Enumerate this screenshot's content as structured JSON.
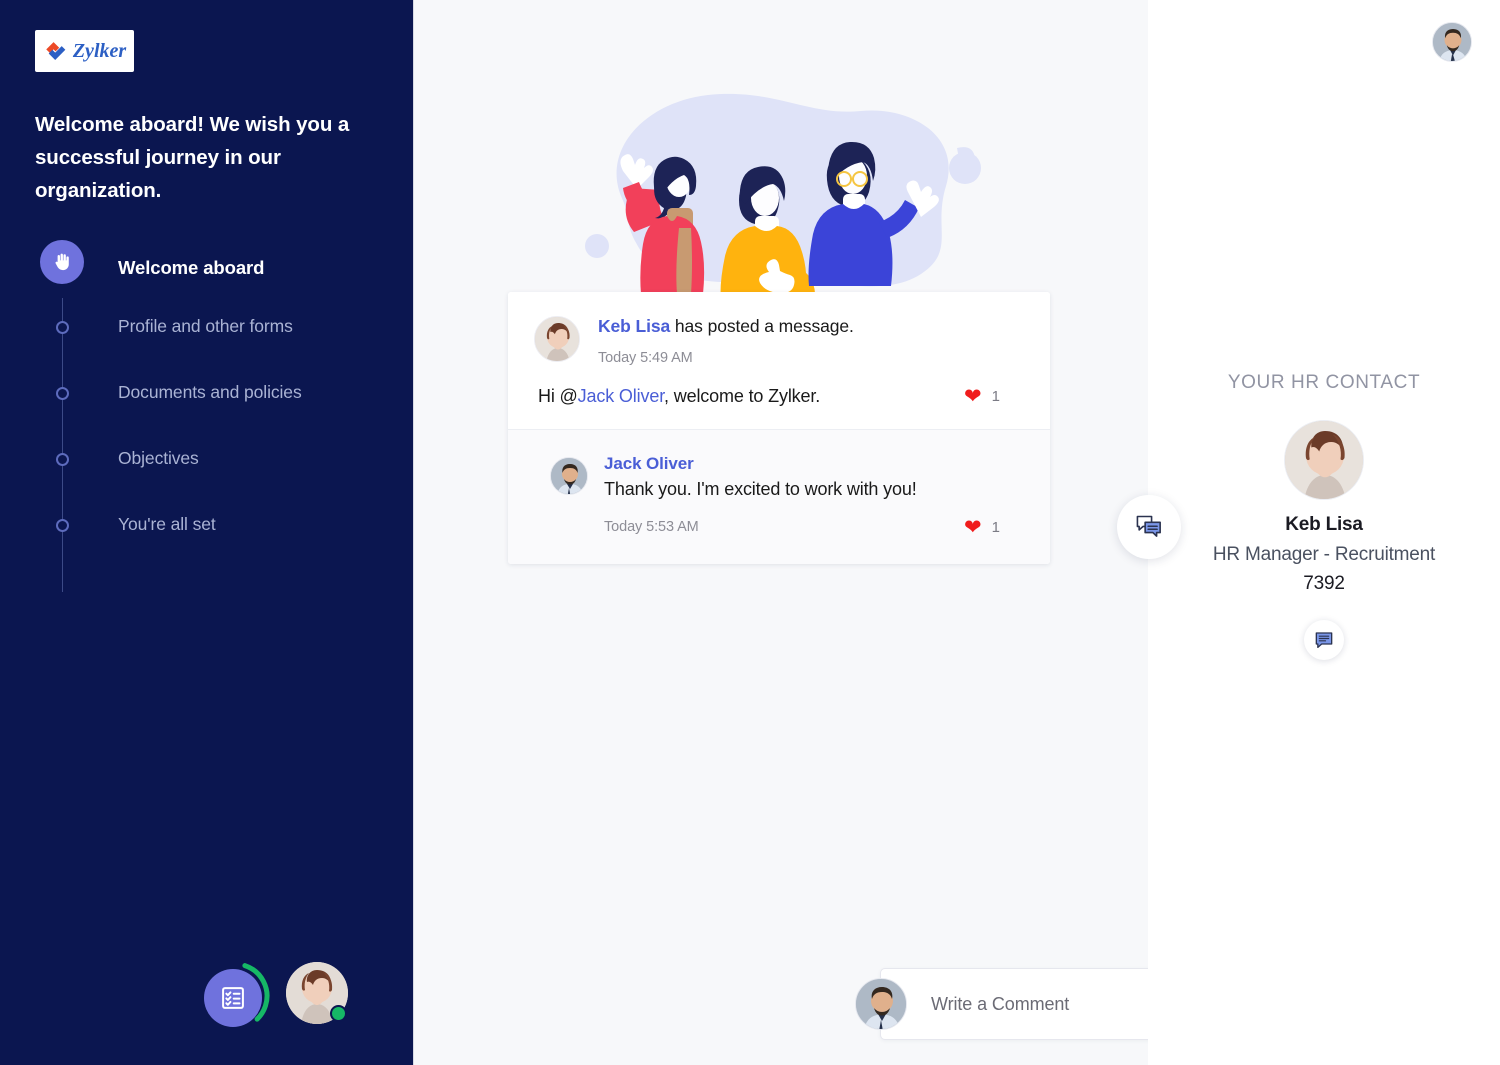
{
  "brand": {
    "name": "Zylker",
    "logo_icon": "zylker-logo-icon"
  },
  "sidebar": {
    "welcome_message": "Welcome aboard! We wish you a successful journey in our organization.",
    "steps": [
      {
        "label": "Welcome aboard",
        "icon": "hand-wave-icon",
        "active": true
      },
      {
        "label": "Profile and other forms",
        "active": false
      },
      {
        "label": "Documents and policies",
        "active": false
      },
      {
        "label": "Objectives",
        "active": false
      },
      {
        "label": "You're all set",
        "active": false
      }
    ],
    "tasks_fab_icon": "checklist-icon",
    "user_avatar_icon": "user-avatar-female",
    "presence": "online"
  },
  "feed": {
    "illustration_icon": "three-people-celebrating-illustration",
    "post": {
      "author": "Keb Lisa",
      "headline_suffix": " has posted a message.",
      "timestamp": "Today 5:49 AM",
      "body_prefix": "Hi @",
      "body_mention": "Jack Oliver",
      "body_suffix": ", welcome to Zylker.",
      "reaction_icon": "heart-icon",
      "reaction_count": "1",
      "avatar_icon": "user-avatar-female"
    },
    "reply": {
      "author": "Jack Oliver",
      "text": "Thank you. I'm excited to work with you!",
      "timestamp": "Today 5:53 AM",
      "reaction_icon": "heart-icon",
      "reaction_count": "1",
      "avatar_icon": "user-avatar-male"
    },
    "composer": {
      "placeholder": "Write a Comment",
      "value": "",
      "avatar_icon": "user-avatar-male"
    },
    "chat_fab_icon": "chat-bubbles-icon"
  },
  "right_panel": {
    "top_avatar_icon": "user-avatar-male",
    "hr_contact": {
      "heading": "YOUR HR CONTACT",
      "name": "Keb Lisa",
      "role": "HR Manager - Recruitment",
      "extension": "7392",
      "avatar_icon": "user-avatar-female",
      "chat_button_icon": "chat-bubble-icon"
    }
  },
  "colors": {
    "sidebar_bg": "#0b1650",
    "accent_purple": "#6f72dd",
    "link_blue": "#4a5ed6",
    "center_bg": "#f7f8fa",
    "heart_red": "#f01c1c",
    "online_green": "#16b866"
  }
}
